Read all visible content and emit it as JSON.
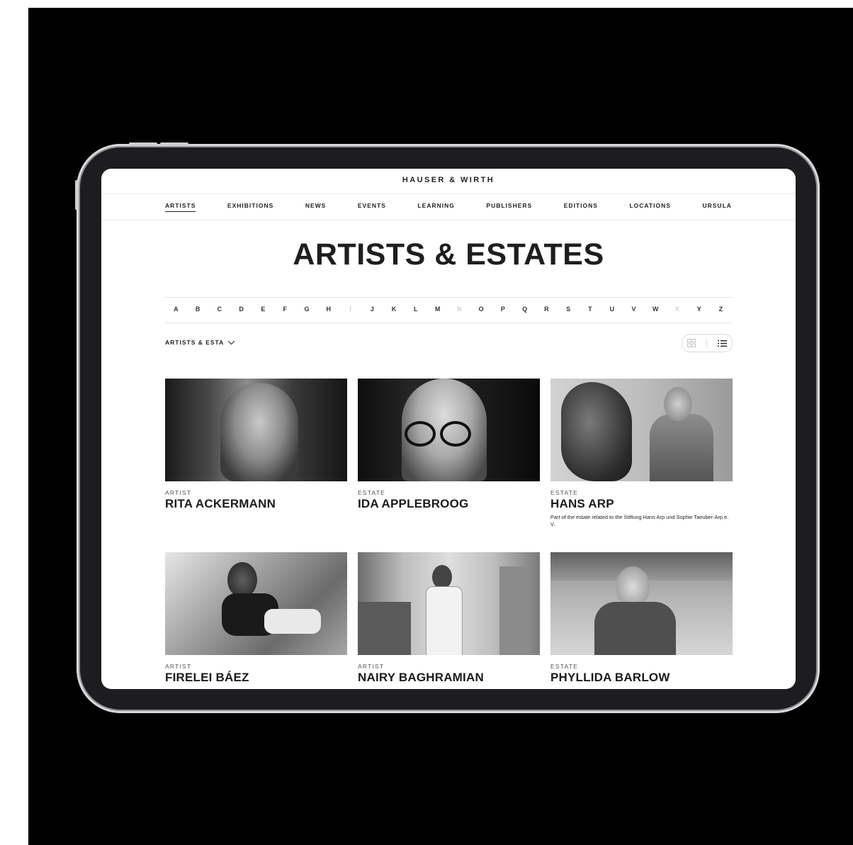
{
  "brand": "HAUSER & WIRTH",
  "nav": [
    "ARTISTS",
    "EXHIBITIONS",
    "NEWS",
    "EVENTS",
    "LEARNING",
    "PUBLISHERS",
    "EDITIONS",
    "LOCATIONS",
    "URSULA"
  ],
  "nav_active": "ARTISTS",
  "page_title": "ARTISTS & ESTATES",
  "alphabet": {
    "letters": [
      "A",
      "B",
      "C",
      "D",
      "E",
      "F",
      "G",
      "H",
      "I",
      "J",
      "K",
      "L",
      "M",
      "N",
      "O",
      "P",
      "Q",
      "R",
      "S",
      "T",
      "U",
      "V",
      "W",
      "X",
      "Y",
      "Z"
    ],
    "disabled": [
      "I",
      "N",
      "X"
    ]
  },
  "filter": {
    "label": "ARTISTS & ESTA",
    "icon": "chevron-down-icon"
  },
  "view_toggle": {
    "grid_icon": "grid-view-icon",
    "list_icon": "list-view-icon"
  },
  "cards": [
    {
      "type": "ARTIST",
      "name": "RITA ACKERMANN",
      "note": ""
    },
    {
      "type": "ESTATE",
      "name": "IDA APPLEBROOG",
      "note": ""
    },
    {
      "type": "ESTATE",
      "name": "HANS ARP",
      "note": "Part of the estate related to the Stiftung Hans Arp  und Sophie Taeuber-Arp e. V."
    },
    {
      "type": "ARTIST",
      "name": "FIRELEI BÁEZ",
      "note": ""
    },
    {
      "type": "ARTIST",
      "name": "NAIRY BAGHRAMIAN",
      "note": ""
    },
    {
      "type": "ESTATE",
      "name": "PHYLLIDA BARLOW",
      "note": ""
    }
  ]
}
